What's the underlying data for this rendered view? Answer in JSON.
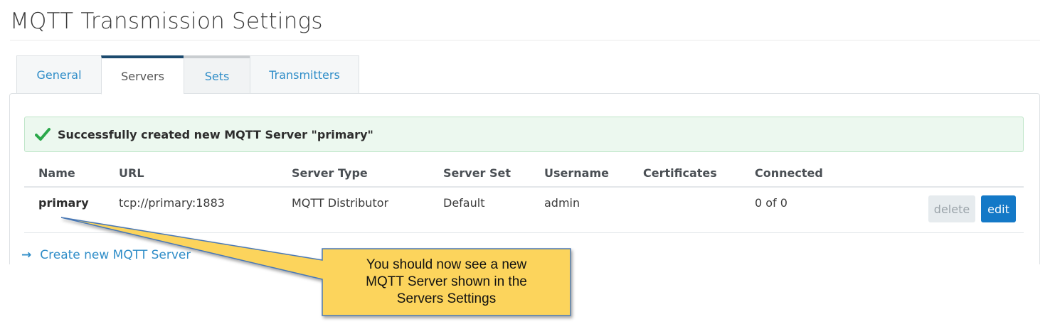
{
  "page": {
    "title": "MQTT Transmission Settings"
  },
  "tabs": [
    {
      "label": "General"
    },
    {
      "label": "Servers"
    },
    {
      "label": "Sets"
    },
    {
      "label": "Transmitters"
    }
  ],
  "alert": {
    "icon": "check-icon",
    "text": "Successfully created new MQTT Server \"primary\"",
    "color": "#2aa84a"
  },
  "table": {
    "headers": [
      "Name",
      "URL",
      "Server Type",
      "Server Set",
      "Username",
      "Certificates",
      "Connected"
    ],
    "rows": [
      {
        "name": "primary",
        "url": "tcp://primary:1883",
        "server_type": "MQTT Distributor",
        "server_set": "Default",
        "username": "admin",
        "certificates": "",
        "connected": "0 of 0",
        "delete_label": "delete",
        "edit_label": "edit"
      }
    ]
  },
  "create_link": {
    "arrow": "→",
    "label": "Create new MQTT Server"
  },
  "callout": {
    "lines": [
      "You should now see a new",
      "MQTT Server shown in the",
      "Servers Settings"
    ],
    "fill": "#fcd45c",
    "stroke": "#4a78b5"
  }
}
